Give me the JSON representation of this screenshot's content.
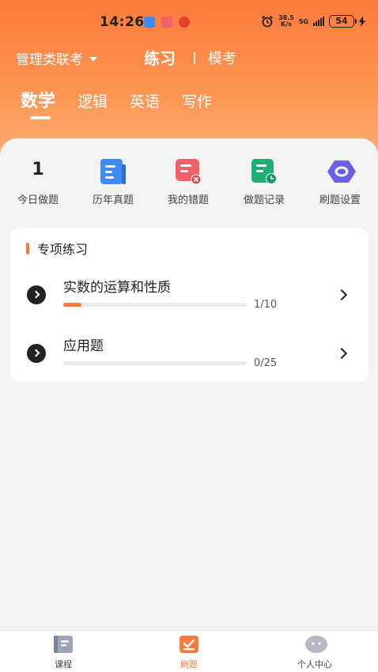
{
  "status_bar": {
    "time": "14:26",
    "net_speed_value": "38.5",
    "net_speed_unit": "K/s",
    "network": "5G",
    "battery": "54"
  },
  "top_nav": {
    "exam_select": "管理类联考",
    "practice_tab": "练习",
    "mock_tab": "模考"
  },
  "subjects": [
    "数学",
    "逻辑",
    "英语",
    "写作"
  ],
  "quick_actions": {
    "today_count": "1",
    "today_label": "今日做题",
    "past_papers": "历年真题",
    "mistakes": "我的错题",
    "records": "做题记录",
    "settings": "刷题设置"
  },
  "special_practice": {
    "title": "专项练习",
    "topics": [
      {
        "name": "实数的运算和性质",
        "progress_text": "1/10",
        "progress": 0.1
      },
      {
        "name": "应用题",
        "progress_text": "0/25",
        "progress": 0.0
      }
    ]
  },
  "tab_bar": {
    "courses": "课程",
    "practice": "刷题",
    "profile": "个人中心"
  },
  "colors": {
    "accent": "#fb7b3c",
    "blue_icon": "#3d8bf7",
    "red_icon": "#f2616a",
    "green_icon": "#1fae76",
    "purple_icon": "#6b5ee8"
  }
}
